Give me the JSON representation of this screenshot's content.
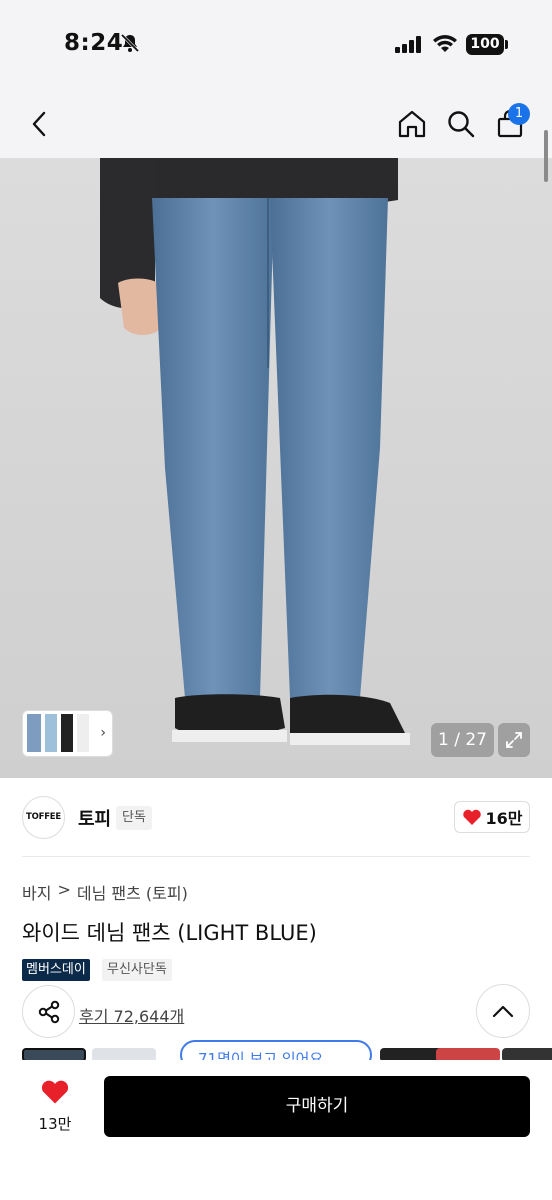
{
  "status_bar": {
    "time": "8:24",
    "battery": "100"
  },
  "nav": {
    "cart_count": "1"
  },
  "gallery": {
    "counter": "1 / 27"
  },
  "brand": {
    "logo_text": "TOFFEE",
    "name": "토피",
    "exclusive_tag": "단독",
    "likes": "16만"
  },
  "breadcrumb": {
    "category": "바지",
    "separator": ">",
    "subcategory": "데님 팬츠 (토피)"
  },
  "product": {
    "title": "와이드 데님 팬츠 (LIGHT BLUE)",
    "tag_member": "멤버스데이",
    "tag_musinsa": "무신사단독",
    "reviews": "후기 72,644개"
  },
  "overlay_pill": {
    "text": "71명이 보고 있어요"
  },
  "bottom_bar": {
    "likes": "13만",
    "buy_label": "구매하기"
  },
  "colors": {
    "accent_blue": "#1a73e8",
    "heart_red": "#e8202a",
    "member_tag": "#0b2a4a",
    "buy_button": "#000000"
  }
}
